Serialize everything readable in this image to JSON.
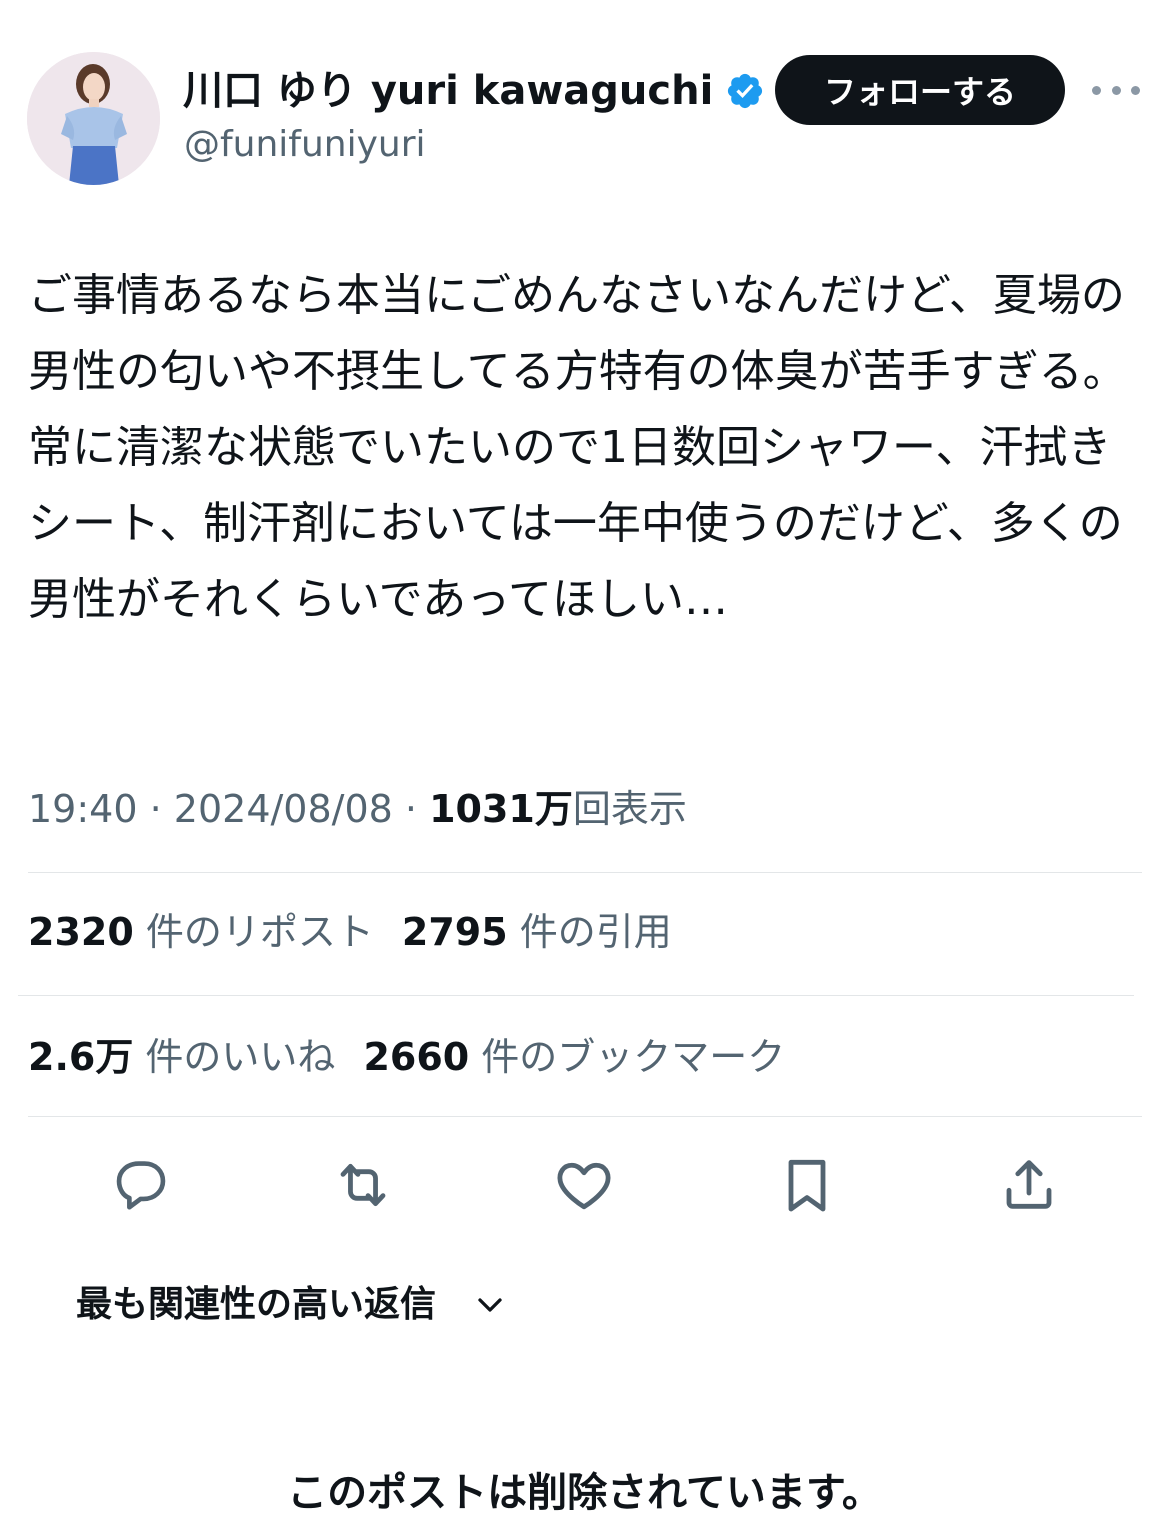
{
  "author": {
    "display_name": "川口 ゆり yuri kawaguchi",
    "handle": "@funifuniyuri",
    "avatar_icon": "profile-photo",
    "verified_icon": "verified-badge-icon",
    "verified_color": "#1d9bf0"
  },
  "header": {
    "follow_label": "フォローする",
    "more_icon": "more-dots-icon"
  },
  "post": {
    "text": "ご事情あるなら本当にごめんなさいなんだけど、夏場の男性の匂いや不摂生してる方特有の体臭が苦手すぎる。常に清潔な状態でいたいので1日数回シャワー、汗拭きシート、制汗剤においては一年中使うのだけど、多くの男性がそれくらいであってほしい…"
  },
  "meta": {
    "time": "19:40",
    "date": "2024/08/08",
    "views_count": "1031万",
    "views_label": "回表示",
    "separator": "·"
  },
  "stats": {
    "reposts_count": "2320",
    "reposts_label": "件のリポスト",
    "quotes_count": "2795",
    "quotes_label": "件の引用",
    "likes_count": "2.6万",
    "likes_label": "件のいいね",
    "bookmarks_count": "2660",
    "bookmarks_label": "件のブックマーク"
  },
  "actions": [
    {
      "name": "reply",
      "icon": "reply-icon"
    },
    {
      "name": "repost",
      "icon": "repost-icon"
    },
    {
      "name": "like",
      "icon": "heart-icon"
    },
    {
      "name": "bookmark",
      "icon": "bookmark-icon"
    },
    {
      "name": "share",
      "icon": "share-icon"
    }
  ],
  "replies": {
    "filter_label": "最も関連性の高い返信",
    "deleted_notice": "このポストは削除されています。"
  },
  "colors": {
    "text": "#0f1419",
    "secondary": "#536471",
    "icon": "#536471",
    "divider": "#e3e6e8",
    "button_bg": "#0f1419"
  }
}
